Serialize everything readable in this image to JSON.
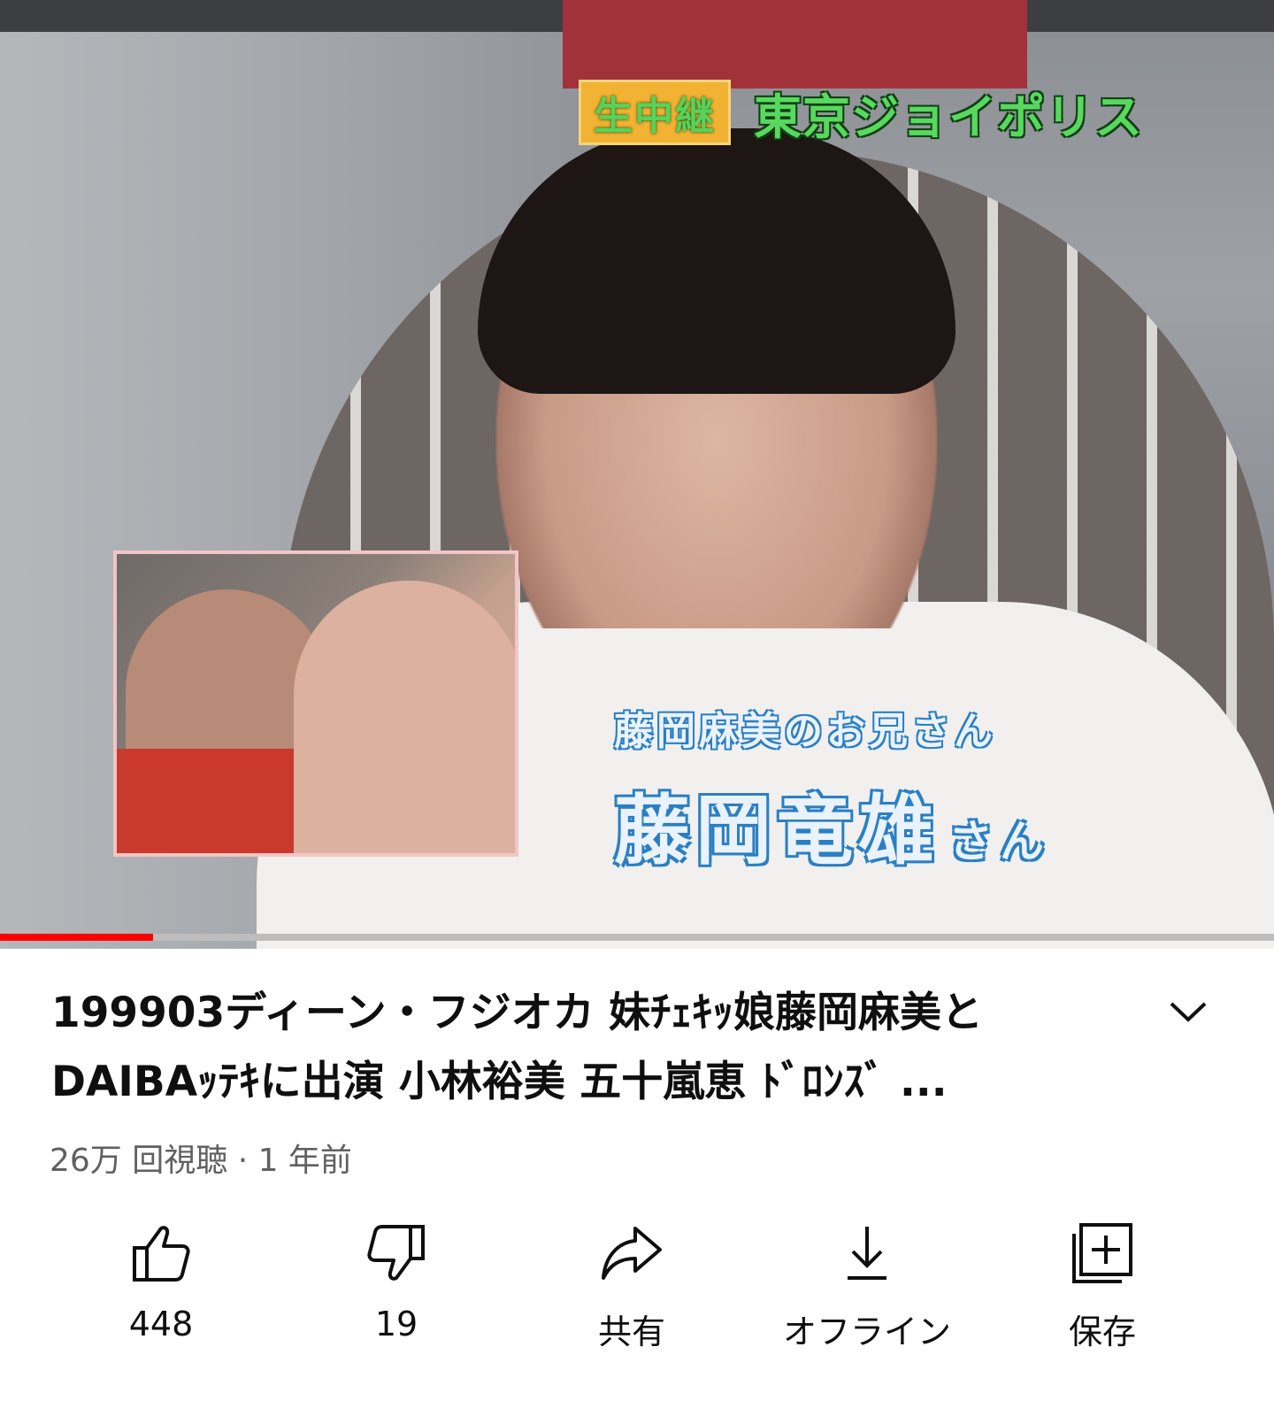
{
  "video": {
    "overlay_live": "生中継",
    "overlay_venue": "東京ジョイポリス",
    "caption_sub": "藤岡麻美のお兄さん",
    "caption_name": "藤岡竜雄",
    "caption_honorific": "さん",
    "progress_fraction": 0.12
  },
  "info": {
    "title": "199903ディーン・フジオカ 妹ﾁｪｷｯ娘藤岡麻美とDAIBAｯﾃｷに出演 小林裕美 五十嵐恵 ﾄﾞﾛﾝｽﾞ ...",
    "meta": "26万 回視聴 · 1 年前"
  },
  "actions": {
    "like_label": "448",
    "dislike_label": "19",
    "share_label": "共有",
    "download_label": "オフライン",
    "save_label": "保存"
  },
  "icons": {
    "expand": "chevron-down-icon",
    "like": "thumbs-up-icon",
    "dislike": "thumbs-down-icon",
    "share": "share-arrow-icon",
    "download": "download-icon",
    "save": "add-to-playlist-icon"
  },
  "colors": {
    "progress": "#ff0000",
    "text_primary": "#0f0f0f",
    "text_secondary": "#606060"
  }
}
